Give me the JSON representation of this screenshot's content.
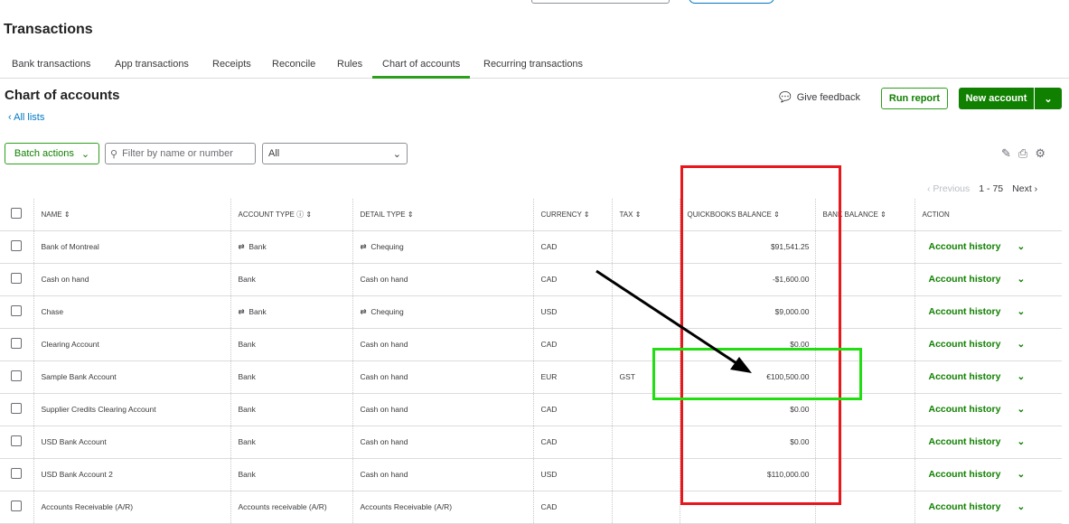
{
  "page_title": "Transactions",
  "tabs": [
    {
      "label": "Bank transactions"
    },
    {
      "label": "App transactions"
    },
    {
      "label": "Receipts"
    },
    {
      "label": "Reconcile"
    },
    {
      "label": "Rules"
    },
    {
      "label": "Chart of accounts"
    },
    {
      "label": "Recurring transactions"
    }
  ],
  "section_title": "Chart of accounts",
  "all_lists": "All lists",
  "give_feedback": "Give feedback",
  "run_report": "Run report",
  "new_account": "New account",
  "batch_actions": "Batch actions",
  "filter_placeholder": "Filter by name or number",
  "type_filter": "All",
  "pager": {
    "previous": "Previous",
    "range": "1 - 75",
    "next": "Next"
  },
  "columns": [
    "NAME",
    "ACCOUNT TYPE",
    "DETAIL TYPE",
    "CURRENCY",
    "TAX",
    "QUICKBOOKS BALANCE",
    "BANK BALANCE",
    "ACTION"
  ],
  "rows": [
    {
      "name": "Bank of Montreal",
      "type": "Bank",
      "detail": "Chequing",
      "linked": true,
      "currency": "CAD",
      "tax": "",
      "qb": "$91,541.25",
      "bank": "",
      "action": "Account history"
    },
    {
      "name": "Cash on hand",
      "type": "Bank",
      "detail": "Cash on hand",
      "linked": false,
      "currency": "CAD",
      "tax": "",
      "qb": "-$1,600.00",
      "bank": "",
      "action": "Account history"
    },
    {
      "name": "Chase",
      "type": "Bank",
      "detail": "Chequing",
      "linked": true,
      "currency": "USD",
      "tax": "",
      "qb": "$9,000.00",
      "bank": "",
      "action": "Account history"
    },
    {
      "name": "Clearing Account",
      "type": "Bank",
      "detail": "Cash on hand",
      "linked": false,
      "currency": "CAD",
      "tax": "",
      "qb": "$0.00",
      "bank": "",
      "action": "Account history"
    },
    {
      "name": "Sample Bank Account",
      "type": "Bank",
      "detail": "Cash on hand",
      "linked": false,
      "currency": "EUR",
      "tax": "GST",
      "qb": "€100,500.00",
      "bank": "",
      "action": "Account history"
    },
    {
      "name": "Supplier Credits Clearing Account",
      "type": "Bank",
      "detail": "Cash on hand",
      "linked": false,
      "currency": "CAD",
      "tax": "",
      "qb": "$0.00",
      "bank": "",
      "action": "Account history"
    },
    {
      "name": "USD Bank Account",
      "type": "Bank",
      "detail": "Cash on hand",
      "linked": false,
      "currency": "CAD",
      "tax": "",
      "qb": "$0.00",
      "bank": "",
      "action": "Account history"
    },
    {
      "name": "USD Bank Account 2",
      "type": "Bank",
      "detail": "Cash on hand",
      "linked": false,
      "currency": "USD",
      "tax": "",
      "qb": "$110,000.00",
      "bank": "",
      "action": "Account history"
    },
    {
      "name": "Accounts Receivable (A/R)",
      "type": "Accounts receivable (A/R)",
      "detail": "Accounts Receivable (A/R)",
      "linked": false,
      "currency": "CAD",
      "tax": "",
      "qb": "",
      "bank": "",
      "action": "Account history"
    }
  ],
  "colors": {
    "accent": "#108000",
    "annotation_red": "#e8171c",
    "annotation_green": "#22dd11"
  }
}
